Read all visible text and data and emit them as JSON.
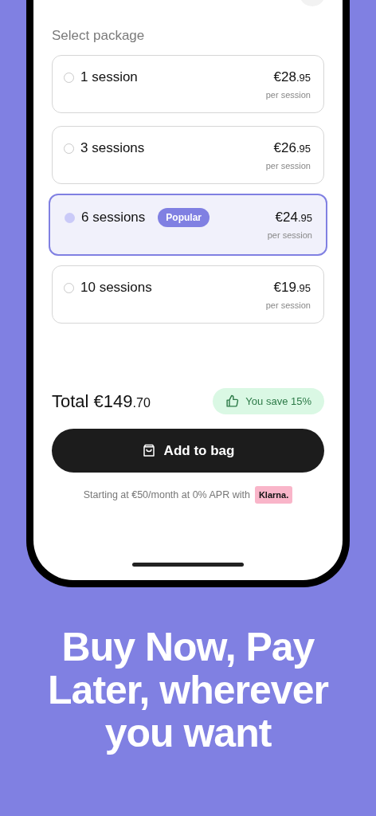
{
  "section_title": "Select package",
  "packages": [
    {
      "label": "1 session",
      "selected": false,
      "price_main": "€28",
      "price_cents": ".95",
      "unit": "per session"
    },
    {
      "label": "3 sessions",
      "selected": false,
      "price_main": "€26",
      "price_cents": ".95",
      "unit": "per session"
    },
    {
      "label": "6 sessions",
      "selected": true,
      "badge": "Popular",
      "price_main": "€24",
      "price_cents": ".95",
      "unit": "per session"
    },
    {
      "label": "10 sessions",
      "selected": false,
      "price_main": "€19",
      "price_cents": ".95",
      "unit": "per session"
    }
  ],
  "total": {
    "label": "Total",
    "amount_main": "€149",
    "amount_cents": ".70"
  },
  "savings": "You save 15%",
  "add_button": "Add to bag",
  "financing": {
    "text": "Starting at €50/month at 0% APR with",
    "provider": "Klarna."
  },
  "headline": [
    "Buy Now, Pay",
    "Later, wherever",
    "you want"
  ]
}
